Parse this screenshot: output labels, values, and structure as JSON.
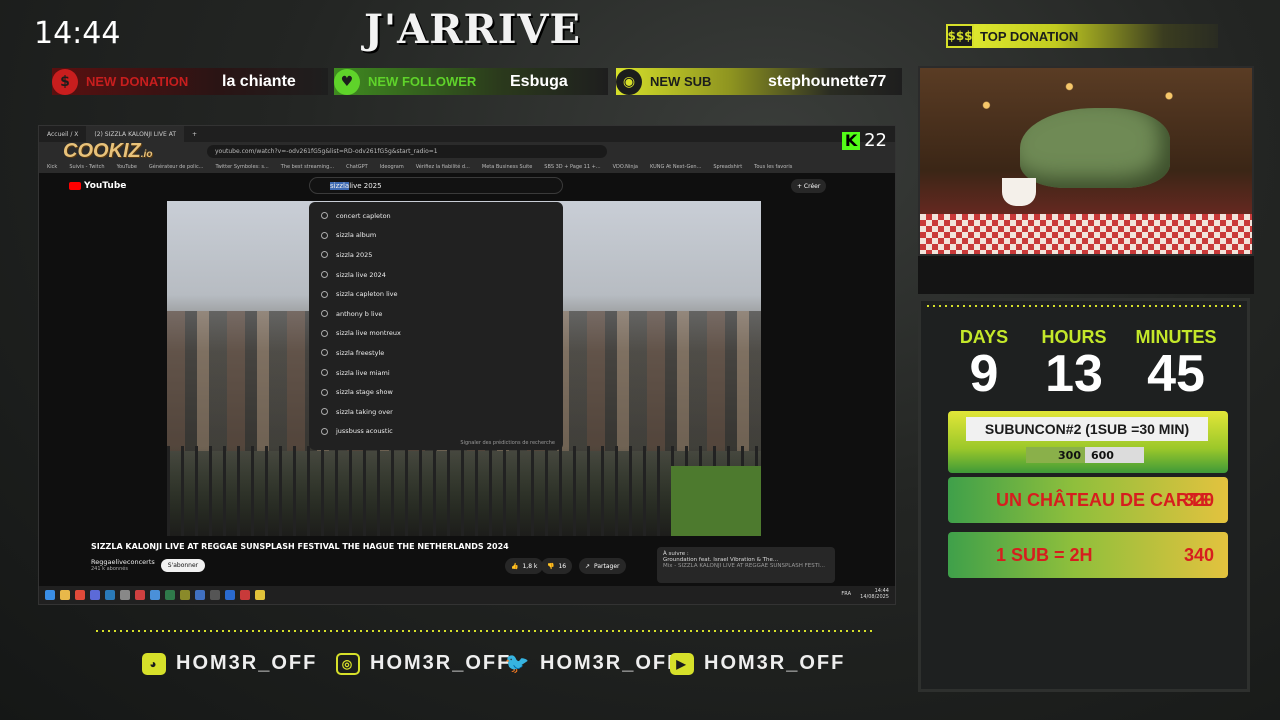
{
  "overlay": {
    "clock": "14:44",
    "brand": "J'ARRIVE",
    "top_donation": {
      "badge": "$$$",
      "label": "TOP DONATION"
    },
    "alerts": [
      {
        "icon": "$",
        "label": "NEW DONATION",
        "value": "la chiante",
        "color": "#c81e1e"
      },
      {
        "icon": "♥",
        "label": "NEW FOLLOWER",
        "value": "Esbuga",
        "color": "#5fd32a"
      },
      {
        "icon": "◉",
        "label": "NEW SUB",
        "value": "stephounette77",
        "color": "#d6e02a"
      }
    ]
  },
  "browser": {
    "tabs": [
      "Accueil / X",
      "(2) SIZZLA KALONJI LIVE AT"
    ],
    "url": "youtube.com/watch?v=-odv261fG5g&list=RD-odv261fG5g&start_radio=1",
    "bookmarks": [
      "Kick",
      "Suivis - Twitch",
      "YouTube",
      "Générateur de polic...",
      "Twitter Symboles: s...",
      "The best streaming...",
      "ChatGPT",
      "Ideogram",
      "Vérifiez la fiabilité d...",
      "Meta Business Suite",
      "SBS 3D + Page 11 +...",
      "VDO.Ninja",
      "KUNG At Next-Gen...",
      "Spreadshirt",
      "Tous les favoris"
    ],
    "cookiz": "COOKIZ",
    "cookiz_suffix": ".io",
    "kick_count": "22"
  },
  "youtube": {
    "logo": "YouTube",
    "search_selected": "sizzla",
    "search_rest": " live 2025",
    "create_label": "+ Créer",
    "suggestions": [
      "concert capleton",
      "sizzla album",
      "sizzla 2025",
      "sizzla live 2024",
      "sizzla capleton live",
      "anthony b live",
      "sizzla live montreux",
      "sizzla freestyle",
      "sizzla live miami",
      "sizzla stage show",
      "sizzla taking over",
      "jussbuss acoustic"
    ],
    "suggest_footer": "Signaler des prédictions de recherche",
    "video_title": "SIZZLA KALONJI LIVE AT REGGAE SUNSPLASH FESTIVAL THE HAGUE THE NETHERLANDS 2024",
    "channel": "Reggaeliveconcerts",
    "subs": "241 k abonnés",
    "subscribe": "S'abonner",
    "likes": "1,8 k",
    "dislikes": "16",
    "share": "Partager",
    "upnext_label": "À suivre :",
    "upnext_title": "Groundation feat. Israel Vibration & The...",
    "upnext_sub": "Mix - SIZZLA KALONJI LIVE AT REGGAE SUNSPLASH FESTI...",
    "taskbar_time": "14:44",
    "taskbar_date": "14/08/2025",
    "taskbar_lang": "FRA"
  },
  "countdown": {
    "days_label": "DAYS",
    "days": "9",
    "hours_label": "HOURS",
    "hours": "13",
    "minutes_label": "MINUTES",
    "minutes": "45"
  },
  "goals": {
    "subuncon": "SUBUNCON#2 (1SUB =30 MIN)",
    "progress_current": "300",
    "progress_target": "600",
    "progress_fraction": 0.5,
    "goal2_name": "UN CHÂTEAU DE CARTE",
    "goal2_count": "320",
    "goal3_name": "1 SUB = 2H",
    "goal3_count": "340"
  },
  "socials": [
    {
      "icon": "discord-icon",
      "handle": "HOM3R_OFF"
    },
    {
      "icon": "instagram-icon",
      "handle": "HOM3R_OFF"
    },
    {
      "icon": "twitter-icon",
      "handle": "HOM3R_OFF"
    },
    {
      "icon": "youtube-icon",
      "handle": "HOM3R_OFF"
    }
  ]
}
